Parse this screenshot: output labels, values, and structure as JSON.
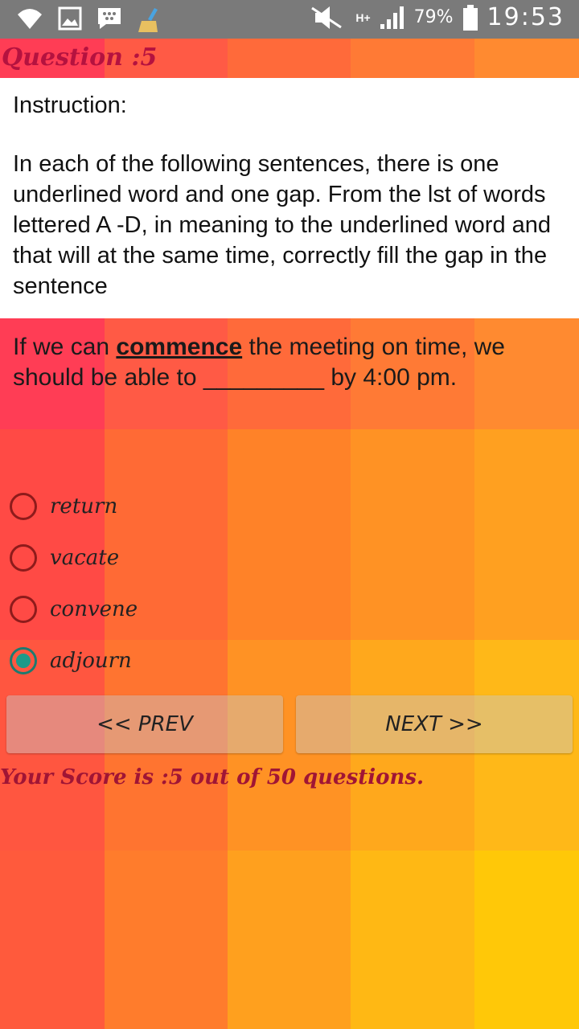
{
  "status_bar": {
    "battery_pct": "79%",
    "time": "19:53",
    "network": "H+",
    "icons": [
      "wifi-icon",
      "image-icon",
      "bbm-icon",
      "broom-icon",
      "mute-icon",
      "signal-icon",
      "battery-icon"
    ]
  },
  "question": {
    "title": "Question :5"
  },
  "instruction": {
    "label": "Instruction:",
    "body": "In each of the following sentences, there is one underlined word and one gap. From the lst of words lettered A -D, in meaning to the underlined word and that will at the same time, correctly fill the gap in the sentence"
  },
  "sentence": {
    "before": "If we can ",
    "keyword": "commence",
    "after": " the meeting on time, we should be able to _________ by 4:00 pm."
  },
  "options": [
    {
      "label": "return",
      "checked": false
    },
    {
      "label": "vacate",
      "checked": false
    },
    {
      "label": "convene",
      "checked": false
    },
    {
      "label": "adjourn",
      "checked": true
    }
  ],
  "buttons": {
    "prev": "<< PREV",
    "next": "NEXT >>"
  },
  "score": {
    "text": "Your Score is  :5 out of 50 questions."
  },
  "colors": {
    "accent_radio": "#1d9a8a",
    "radio_border": "#8e1b1b",
    "header_text": "#b5123f"
  }
}
